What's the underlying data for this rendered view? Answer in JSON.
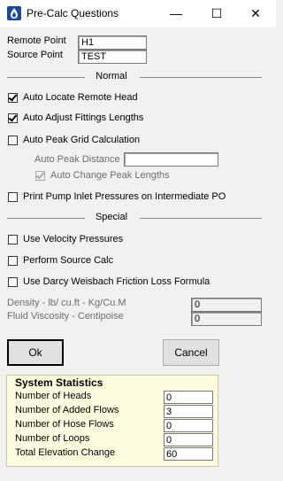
{
  "window": {
    "title": "Pre-Calc Questions",
    "min_glyph": "—",
    "max_glyph": "☐",
    "close_glyph": "✕"
  },
  "points": {
    "remote_label": "Remote Point",
    "remote_value": "H1",
    "source_label": "Source Point",
    "source_value": "TEST"
  },
  "normal": {
    "heading": "Normal",
    "auto_locate": {
      "label": "Auto Locate Remote Head",
      "checked": true
    },
    "auto_adjust": {
      "label": "Auto Adjust Fittings Lengths",
      "checked": true
    },
    "auto_peak_grid": {
      "label": "Auto Peak Grid Calculation",
      "checked": false
    },
    "auto_peak_distance_label": "Auto Peak Distance",
    "auto_peak_distance_value": "",
    "auto_change_peak": {
      "label": "Auto Change Peak Lengths",
      "checked": true,
      "disabled": true
    },
    "print_pump": {
      "label": "Print Pump Inlet Pressures on Intermediate PO",
      "checked": false
    }
  },
  "special": {
    "heading": "Special",
    "velocity": {
      "label": "Use Velocity Pressures",
      "checked": false
    },
    "source_calc": {
      "label": "Perform Source Calc",
      "checked": false
    },
    "darcy": {
      "label": "Use Darcy Weisbach Friction Loss Formula",
      "checked": false
    },
    "density_label": "Density - lb/ cu.ft - Kg/Cu.M",
    "density_value": "0",
    "viscosity_label": "Fluid Viscosity - Centipoise",
    "viscosity_value": "0"
  },
  "buttons": {
    "ok": "Ok",
    "cancel": "Cancel"
  },
  "stats": {
    "title": "System Statistics",
    "rows": [
      {
        "label": "Number of Heads",
        "value": "0"
      },
      {
        "label": "Number of Added Flows",
        "value": "3"
      },
      {
        "label": "Number of Hose Flows",
        "value": "0"
      },
      {
        "label": "Number of Loops",
        "value": "0"
      },
      {
        "label": "Total Elevation Change",
        "value": "60"
      }
    ]
  }
}
